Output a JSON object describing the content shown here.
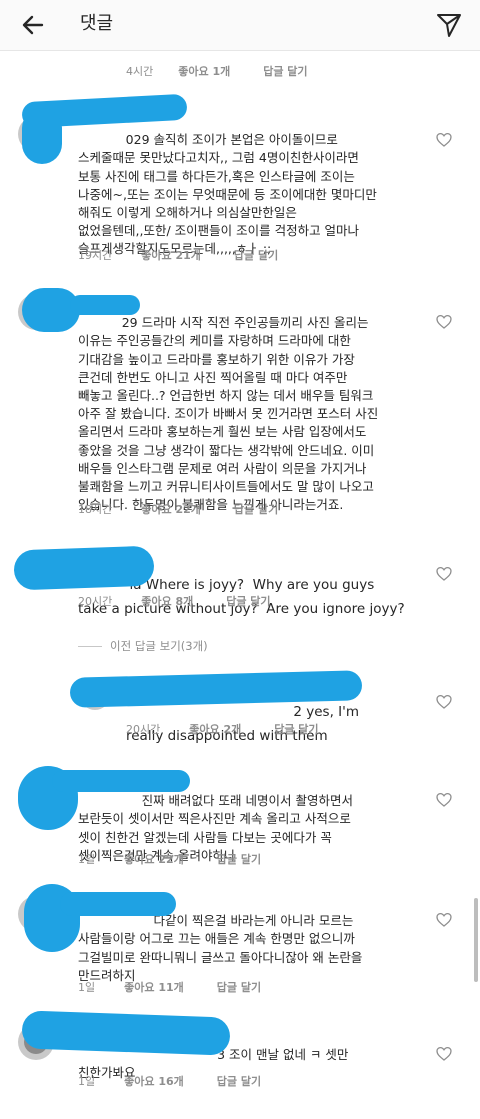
{
  "header": {
    "title": "댓글",
    "back_icon": "arrow-left-icon",
    "direct_icon": "paper-plane-icon"
  },
  "top_meta": {
    "time": "4시간",
    "likes": "좋아요 1개",
    "reply": "답글 달기"
  },
  "comments": [
    {
      "lines": [
        "            029 솔직히 조이가 본업은 아이돌이므로",
        "스케줄때문 못만났다고치자,, 그럼 4명이친한사이라면",
        "보통 사진에 태그를 하다든가,혹은 인스타글에 조이는",
        "나중에~,또는 조이는 무엇때문에 등 조이에대한 몇마디만",
        "해줘도 이렇게 오해하거나 의심살만한일은",
        "없었을텐데,,또한/ 조이팬들이 조이를 걱정하고 얼마나",
        "슬프게생각할지도모르는데,,,,,ㅎㅏ ;;"
      ],
      "time": "19시간",
      "likes": "좋아요 21개",
      "reply": "답글 달기"
    },
    {
      "lines": [
        "           29 드라마 시작 직전 주인공들끼리 사진 올리는",
        "이유는 주인공들간의 케미를 자랑하며 드라마에 대한",
        "기대감을 높이고 드라마를 홍보하기 위한 이유가 가장",
        "큰건데 한번도 아니고 사진 찍어올릴 때 마다 여주만",
        "빼놓고 올린다..? 언급한번 하지 않는 데서 배우들 팀워크",
        "아주 잘 봤습니다. 조이가 바빠서 못 낀거라면 포스터 사진",
        "올리면서 드라마 홍보하는게 훨씬 보는 사람 입장에서도",
        "좋았을 것을 그냥 생각이 짧다는 생각밖에 안드네요. 이미",
        "배우들 인스타그램 문제로 여러 사람이 의문을 가지거나",
        "불쾌함을 느끼고 커뮤니티사이트들에서도 말 많이 나오고",
        "있습니다. 한두명이 불쾌함을 느낀게 아니라는거죠."
      ],
      "time": "18시간",
      "likes": "좋아요 22개",
      "reply": "답글 달기"
    },
    {
      "lines": [
        "            ia Where is joyy?  Why are you guys",
        "take a picture without joy?  Are you ignore joyy?"
      ],
      "time": "20시간",
      "likes": "좋아요 8개",
      "reply": "답글 달기"
    }
  ],
  "view_replies": "이전 답글 보기(3개)",
  "reply_comment": {
    "lines": [
      "                                       2 yes, I'm",
      "really disappointed with them"
    ],
    "time": "20시간",
    "likes": "좋아요 2개",
    "reply": "답글 달기"
  },
  "comments2": [
    {
      "lines": [
        "                진짜 배려없다 또래 네명이서 촬영하면서",
        "보란듯이 셋이서만 찍은사진만 계속 올리고 사적으로",
        "셋이 친한건 알겠는데 사람들 다보는 곳에다가 꼭",
        "셋이찍은것만 계속 올려야하나"
      ],
      "time": "1일",
      "likes": "좋아요 22개",
      "reply": "답글 달기"
    },
    {
      "lines": [
        "                   다같이 찍은걸 바라는게 아니라 모르는",
        "사람들이랑 어그로 끄는 애들은 계속 한명만 없으니까",
        "그걸빌미로 완따니뭐니 글쓰고 돌아다니잖아 왜 논란을",
        "만드려하지"
      ],
      "time": "1일",
      "likes": "좋아요 11개",
      "reply": "답글 달기"
    },
    {
      "lines": [
        "                                   3 조이 맨날 없네 ㅋ 셋만",
        "친한가봐요"
      ],
      "time": "1일",
      "likes": "좋아요 16개",
      "reply": "답글 달기"
    }
  ],
  "colors": {
    "redaction": "#1fa2e3",
    "meta": "#8e8e8e",
    "text": "#262626"
  },
  "icons": {
    "like": "heart-outline-icon"
  }
}
